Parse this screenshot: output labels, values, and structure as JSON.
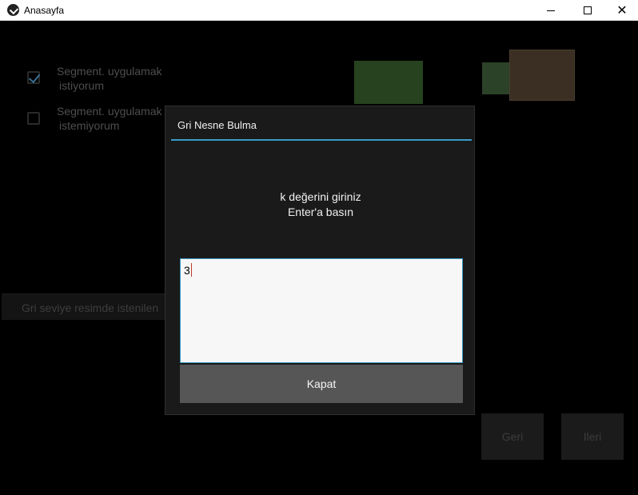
{
  "window": {
    "title": "Anasayfa",
    "controls": {
      "minimize_icon": "minimize-icon",
      "maximize_icon": "maximize-icon",
      "close_glyph": "✕"
    }
  },
  "options": [
    {
      "label_line1": "Segment. uygulamak",
      "label_line2": "istiyorum",
      "checked": true
    },
    {
      "label_line1": "Segment. uygulamak",
      "label_line2": "istemiyorum",
      "checked": false
    }
  ],
  "gray_bar": {
    "text": "Gri seviye resimde istenilen"
  },
  "nav": {
    "back_label": "Geri",
    "next_label": "Ileri"
  },
  "dialog": {
    "title": "Gri Nesne Bulma",
    "message_line1": "k değerini giriniz",
    "message_line2": "Enter'a basın",
    "input_value": "3",
    "close_label": "Kapat",
    "accent_color": "#3a9bc8"
  }
}
